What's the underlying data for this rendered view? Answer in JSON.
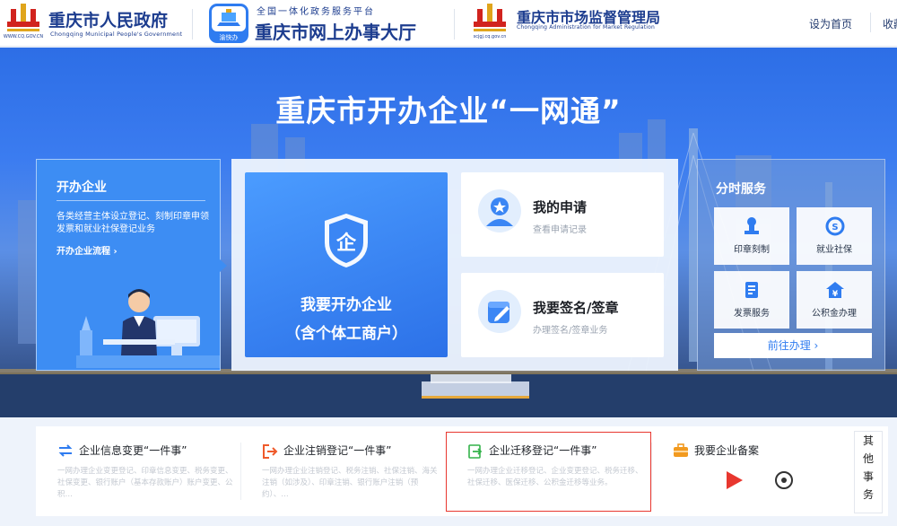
{
  "header": {
    "gov": {
      "title": "重庆市人民政府",
      "subtitle": "Chongqing Municipal People's Government",
      "url": "WWW.CQ.GOV.CN"
    },
    "hall": {
      "tagline": "全国一体化政务服务平台",
      "title": "重庆市网上办事大厅",
      "badge": "渝快办"
    },
    "market": {
      "title": "重庆市市场监督管理局",
      "subtitle": "Chongqing  Administration for Market Regulation",
      "url": "scjgj.cq.gov.cn"
    },
    "links": {
      "home": "设为首页",
      "favorite": "收藏"
    }
  },
  "hero": {
    "title": "重庆市开办企业“一网通”"
  },
  "left_card": {
    "title": "开办企业",
    "description": "各类经营主体设立登记、刻制印章申领发票和就业社保登记业务",
    "link": "开办企业流程 ›"
  },
  "main_card": {
    "line1": "我要开办企业",
    "line2": "（含个体工商户）"
  },
  "quick_cards": [
    {
      "title": "我的申请",
      "subtitle": "查看申请记录"
    },
    {
      "title": "我要签名/签章",
      "subtitle": "办理签名/签章业务"
    }
  ],
  "time_services": {
    "title": "分时服务",
    "items": [
      {
        "label": "印章刻制",
        "icon": "seal-icon"
      },
      {
        "label": "就业社保",
        "icon": "social-security-icon"
      },
      {
        "label": "发票服务",
        "icon": "invoice-icon"
      },
      {
        "label": "公积金办理",
        "icon": "housing-fund-icon"
      }
    ],
    "button": "前往办理 ›"
  },
  "businesses": [
    {
      "title": "企业信息变更“一件事”",
      "desc": "一网办理企业变更登记、印章信息变更、税务变更、社保变更、银行账户（基本存款账户）账户变更、公积…",
      "icon": "swap-arrows-icon"
    },
    {
      "title": "企业注销登记“一件事”",
      "desc": "一网办理企业注销登记、税务注销、社保注销、海关注销（如涉及）、印章注销、银行账户注销（预约）、…",
      "icon": "logout-icon"
    },
    {
      "title": "企业迁移登记“一件事”",
      "desc": "一网办理企业迁移登记、企业变更登记、税务迁移、社保迁移、医保迁移、公积金迁移等业务。",
      "icon": "relocate-icon"
    },
    {
      "title": "我要企业备案",
      "desc": "",
      "icon": "briefcase-icon"
    }
  ],
  "side_tab": [
    "其",
    "他",
    "事",
    "务"
  ],
  "colors": {
    "primary": "#2f7cf0",
    "highlight": "#e8372f",
    "navy": "#1d3d8f"
  }
}
